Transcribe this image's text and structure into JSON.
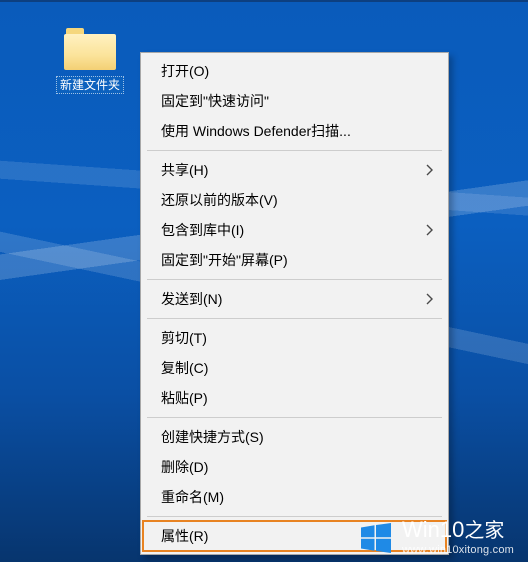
{
  "desktop": {
    "folder_label": "新建文件夹"
  },
  "context_menu": {
    "items": [
      {
        "label": "打开(O)",
        "submenu": false
      },
      {
        "label": "固定到\"快速访问\"",
        "submenu": false
      },
      {
        "label": "使用 Windows Defender扫描...",
        "submenu": false
      },
      {
        "sep": true
      },
      {
        "label": "共享(H)",
        "submenu": true
      },
      {
        "label": "还原以前的版本(V)",
        "submenu": false
      },
      {
        "label": "包含到库中(I)",
        "submenu": true
      },
      {
        "label": "固定到\"开始\"屏幕(P)",
        "submenu": false
      },
      {
        "sep": true
      },
      {
        "label": "发送到(N)",
        "submenu": true
      },
      {
        "sep": true
      },
      {
        "label": "剪切(T)",
        "submenu": false
      },
      {
        "label": "复制(C)",
        "submenu": false
      },
      {
        "label": "粘贴(P)",
        "submenu": false
      },
      {
        "sep": true
      },
      {
        "label": "创建快捷方式(S)",
        "submenu": false
      },
      {
        "label": "删除(D)",
        "submenu": false
      },
      {
        "label": "重命名(M)",
        "submenu": false
      },
      {
        "sep": true
      },
      {
        "label": "属性(R)",
        "submenu": false,
        "highlight": true
      }
    ]
  },
  "watermark": {
    "brand_prefix": "Win",
    "brand_num": "10",
    "brand_suffix": "之家",
    "url": "www.win10xitong.com",
    "logo_color": "#1f8ae6"
  }
}
